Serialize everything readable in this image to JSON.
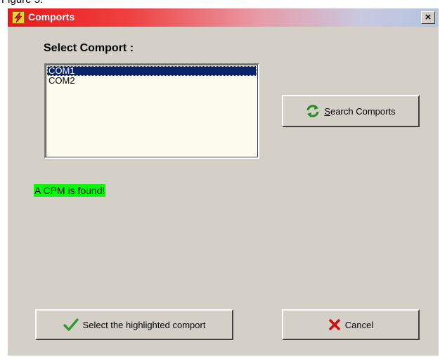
{
  "caption": "Figure 5.",
  "window": {
    "title": "Comports",
    "close_label": "×"
  },
  "select_label": "Select Comport :",
  "comports": [
    {
      "label": "COM1",
      "selected": true
    },
    {
      "label": "COM2",
      "selected": false
    }
  ],
  "buttons": {
    "search_access_key": "S",
    "search_rest": "earch Comports",
    "select": "Select the highlighted comport",
    "cancel": "Cancel"
  },
  "status_text": "A CPM is found!",
  "icons": {
    "app": "lightning-icon",
    "search": "refresh-icon",
    "select": "checkmark-icon",
    "cancel": "x-icon"
  },
  "colors": {
    "status_bg": "#00ff00",
    "selection_bg": "#0a246a",
    "title_start": "#e81818",
    "check": "#2e9a2e",
    "cancel_x": "#cc1010"
  }
}
